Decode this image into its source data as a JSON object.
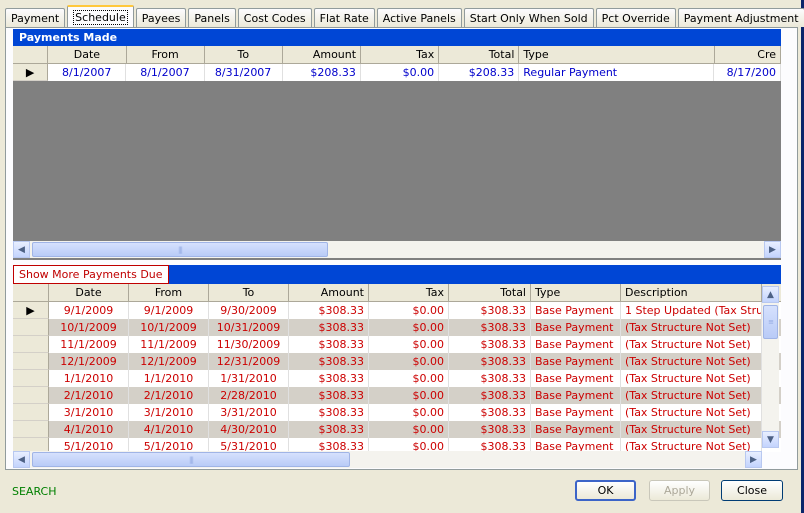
{
  "tabs": [
    "Payment",
    "Schedule",
    "Payees",
    "Panels",
    "Cost Codes",
    "Flat Rate",
    "Active Panels",
    "Start Only When Sold",
    "Pct Override",
    "Payment Adjustment"
  ],
  "active_tab": "Schedule",
  "payments_made": {
    "caption": "Payments Made",
    "columns": [
      "Date",
      "From",
      "To",
      "Amount",
      "Tax",
      "Total",
      "Type",
      "Cre"
    ],
    "rows": [
      [
        "8/1/2007",
        "8/1/2007",
        "8/31/2007",
        "$208.33",
        "$0.00",
        "$208.33",
        "Regular Payment",
        "8/17/200"
      ]
    ]
  },
  "payments_due": {
    "button": "Show More Payments Due",
    "columns": [
      "Date",
      "From",
      "To",
      "Amount",
      "Tax",
      "Total",
      "Type",
      "Description"
    ],
    "rows": [
      [
        "9/1/2009",
        "9/1/2009",
        "9/30/2009",
        "$308.33",
        "$0.00",
        "$308.33",
        "Base Payment",
        "1 Step Updated (Tax Structu"
      ],
      [
        "10/1/2009",
        "10/1/2009",
        "10/31/2009",
        "$308.33",
        "$0.00",
        "$308.33",
        "Base Payment",
        "(Tax Structure Not Set)"
      ],
      [
        "11/1/2009",
        "11/1/2009",
        "11/30/2009",
        "$308.33",
        "$0.00",
        "$308.33",
        "Base Payment",
        "(Tax Structure Not Set)"
      ],
      [
        "12/1/2009",
        "12/1/2009",
        "12/31/2009",
        "$308.33",
        "$0.00",
        "$308.33",
        "Base Payment",
        "(Tax Structure Not Set)"
      ],
      [
        "1/1/2010",
        "1/1/2010",
        "1/31/2010",
        "$308.33",
        "$0.00",
        "$308.33",
        "Base Payment",
        "(Tax Structure Not Set)"
      ],
      [
        "2/1/2010",
        "2/1/2010",
        "2/28/2010",
        "$308.33",
        "$0.00",
        "$308.33",
        "Base Payment",
        "(Tax Structure Not Set)"
      ],
      [
        "3/1/2010",
        "3/1/2010",
        "3/31/2010",
        "$308.33",
        "$0.00",
        "$308.33",
        "Base Payment",
        "(Tax Structure Not Set)"
      ],
      [
        "4/1/2010",
        "4/1/2010",
        "4/30/2010",
        "$308.33",
        "$0.00",
        "$308.33",
        "Base Payment",
        "(Tax Structure Not Set)"
      ],
      [
        "5/1/2010",
        "5/1/2010",
        "5/31/2010",
        "$308.33",
        "$0.00",
        "$308.33",
        "Base Payment",
        "(Tax Structure Not Set)"
      ]
    ]
  },
  "footer": {
    "status": "SEARCH",
    "ok": "OK",
    "apply": "Apply",
    "close": "Close"
  },
  "colors": {
    "caption_bg": "#0046d5",
    "paid_text": "#0000cc",
    "due_text": "#cc0000",
    "status_text": "#008000"
  }
}
